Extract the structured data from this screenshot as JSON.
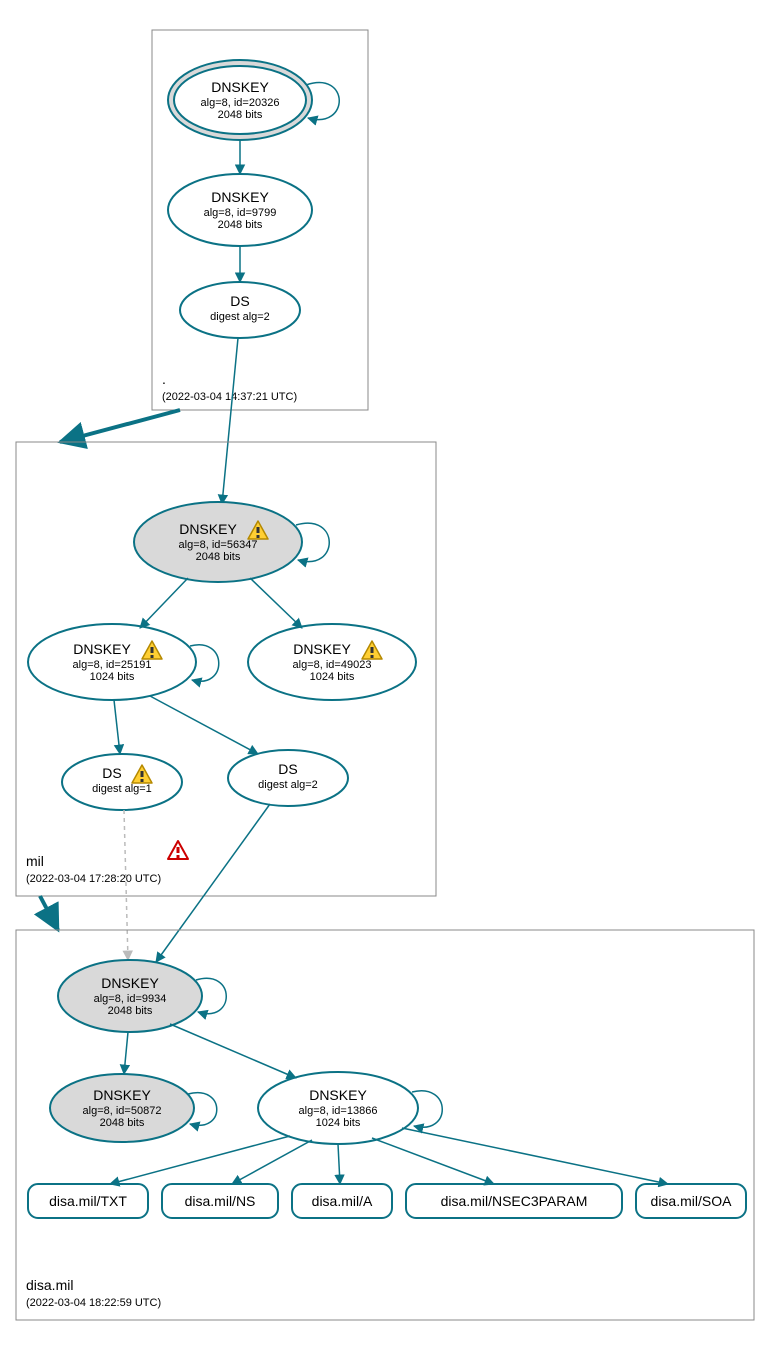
{
  "colors": {
    "stroke": "#0b7285",
    "grayfill": "#d9d9d9"
  },
  "zones": {
    "root": {
      "label": ".",
      "time": "(2022-03-04 14:37:21 UTC)"
    },
    "mil": {
      "label": "mil",
      "time": "(2022-03-04 17:28:20 UTC)"
    },
    "disa": {
      "label": "disa.mil",
      "time": "(2022-03-04 18:22:59 UTC)"
    }
  },
  "nodes": {
    "root_ksk": {
      "title": "DNSKEY",
      "line2": "alg=8, id=20326",
      "line3": "2048 bits",
      "warn": false
    },
    "root_zsk": {
      "title": "DNSKEY",
      "line2": "alg=8, id=9799",
      "line3": "2048 bits",
      "warn": false
    },
    "root_ds": {
      "title": "DS",
      "line2": "digest alg=2",
      "line3": "",
      "warn": false
    },
    "mil_ksk": {
      "title": "DNSKEY",
      "line2": "alg=8, id=56347",
      "line3": "2048 bits",
      "warn": true
    },
    "mil_zsk1": {
      "title": "DNSKEY",
      "line2": "alg=8, id=25191",
      "line3": "1024 bits",
      "warn": true
    },
    "mil_zsk2": {
      "title": "DNSKEY",
      "line2": "alg=8, id=49023",
      "line3": "1024 bits",
      "warn": true
    },
    "mil_ds1": {
      "title": "DS",
      "line2": "digest alg=1",
      "line3": "",
      "warn": true
    },
    "mil_ds2": {
      "title": "DS",
      "line2": "digest alg=2",
      "line3": "",
      "warn": false
    },
    "disa_ksk": {
      "title": "DNSKEY",
      "line2": "alg=8, id=9934",
      "line3": "2048 bits",
      "warn": false
    },
    "disa_sk2": {
      "title": "DNSKEY",
      "line2": "alg=8, id=50872",
      "line3": "2048 bits",
      "warn": false
    },
    "disa_zsk": {
      "title": "DNSKEY",
      "line2": "alg=8, id=13866",
      "line3": "1024 bits",
      "warn": false
    }
  },
  "records": {
    "txt": "disa.mil/TXT",
    "ns": "disa.mil/NS",
    "a": "disa.mil/A",
    "n3p": "disa.mil/NSEC3PARAM",
    "soa": "disa.mil/SOA"
  }
}
